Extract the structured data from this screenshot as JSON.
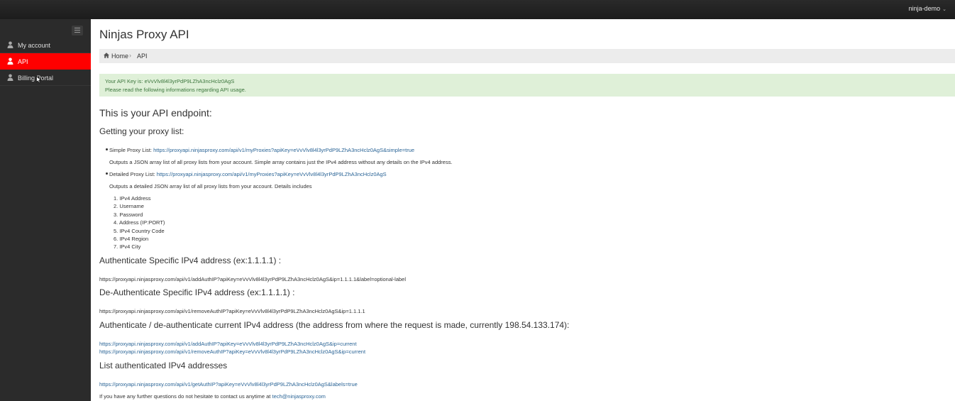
{
  "topbar": {
    "user": "ninja-demo"
  },
  "sidebar": {
    "items": [
      {
        "label": "My account",
        "active": false
      },
      {
        "label": "API",
        "active": true
      },
      {
        "label": "Billing Portal",
        "active": false
      }
    ]
  },
  "main": {
    "title": "Ninjas Proxy API",
    "breadcrumb": [
      "Home",
      "API"
    ],
    "alert": {
      "line1": "Your API Key is: eVvVlv8l4l3yrPdP9LZhA3ncHclz0AgS",
      "line2": "Please read the following informations regarding API usage."
    },
    "endpoint_heading": "This is your API endpoint:",
    "proxy_heading": "Getting your proxy list:",
    "simple_label": "Simple Proxy List: ",
    "simple_url": "https://proxyapi.ninjasproxy.com/api/v1/myProxies?apiKey=eVvVlv8l4l3yrPdP9LZhA3ncHclz0AgS&simple=true",
    "simple_desc": "Outputs a JSON array list of all proxy lists from your account. Simple array contains just the IPv4 address without any details on the IPv4 address.",
    "detailed_label": "Detailed Proxy List: ",
    "detailed_url": "https://proxyapi.ninjasproxy.com/api/v1/myProxies?apiKey=eVvVlv8l4l3yrPdP9LZhA3ncHclz0AgS",
    "detailed_desc": "Outputs a detailed JSON array list of all proxy lists from your account. Details includes",
    "details": [
      "IPv4 Address",
      "Username",
      "Password",
      "Address (IP:PORT)",
      "IPv4 Country Code",
      "IPv4 Region",
      "IPv4 City"
    ],
    "auth_heading": "Authenticate Specific IPv4 address (ex:1.1.1.1) :",
    "auth_url": "https://proxyapi.ninjasproxy.com/api/v1/addAuthIP?apiKey=eVvVlv8l4l3yrPdP9LZhA3ncHclz0AgS&ip=1.1.1.1&label=optional-label",
    "deauth_heading": "De-Authenticate Specific IPv4 address (ex:1.1.1.1) :",
    "deauth_url": "https://proxyapi.ninjasproxy.com/api/v1/removeAuthIP?apiKey=eVvVlv8l4l3yrPdP9LZhA3ncHclz0AgS&ip=1.1.1.1",
    "current_heading": "Authenticate / de-authenticate current IPv4 address (the address from where the request is made, currently 198.54.133.174):",
    "current_add_url": "https://proxyapi.ninjasproxy.com/api/v1/addAuthIP?apiKey=eVvVlv8l4l3yrPdP9LZhA3ncHclz0AgS&ip=current",
    "current_remove_url": "https://proxyapi.ninjasproxy.com/api/v1/removeAuthIP?apiKey=eVvVlv8l4l3yrPdP9LZhA3ncHclz0AgS&ip=current",
    "list_heading": "List authenticated IPv4 addresses",
    "list_url": "https://proxyapi.ninjasproxy.com/api/v1/getAuthIP?apiKey=eVvVlv8l4l3yrPdP9LZhA3ncHclz0AgS&labels=true",
    "contact_text": "If you have any further questions do not hesitate to contact us anytime at ",
    "contact_email": "tech@ninjasproxy.com"
  },
  "colors": {
    "accent": "#ff0000",
    "sidebar_bg": "#2b2b2b",
    "topbar_bg": "#1c1c1c",
    "link": "#2a6496",
    "alert_bg": "#dff0d8",
    "alert_text": "#3c763d"
  }
}
